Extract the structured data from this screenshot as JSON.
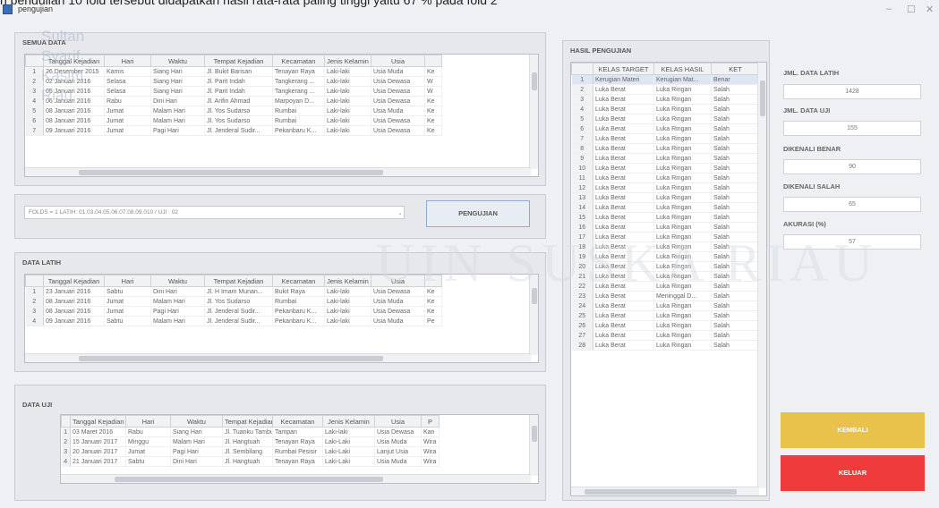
{
  "top_caption": "n pengujian 10 fold tersebut didapatkan hasil rata-rata paling tinggi yaitu 67 % pada fold 2",
  "window": {
    "title": "pengujian",
    "min": "–",
    "max": "☐",
    "close": "✕"
  },
  "semua": {
    "title": "SEMUA DATA",
    "headers": [
      "",
      "Tanggal Kejadian",
      "Hari",
      "Waktu",
      "Tempat Kejadian",
      "Kecamatan",
      "Jenis Kelamin",
      "Usia",
      ""
    ],
    "rows": [
      [
        "1",
        "26 Desember 2015",
        "Kamis",
        "Siang Hari",
        "Jl. Bukit Barisan",
        "Tenayan Raya",
        "Laki-laki",
        "Usia Muda",
        "Ke"
      ],
      [
        "2",
        "02 Januari 2016",
        "Selasa",
        "Siang Hari",
        "Jl. Parit Indah",
        "Tangkerang ...",
        "Laki-laki",
        "Usia Dewasa",
        "W"
      ],
      [
        "3",
        "05 Januari 2016",
        "Selasa",
        "Siang Hari",
        "Jl. Parit Indah",
        "Tangkerang ...",
        "Laki-laki",
        "Usia Dewasa",
        "W"
      ],
      [
        "4",
        "06 Januari 2016",
        "Rabu",
        "Dini Hari",
        "Jl. Arifin Ahmad",
        "Marpoyan D...",
        "Laki-laki",
        "Usia Dewasa",
        "Ke"
      ],
      [
        "5",
        "08 Januari 2016",
        "Jumat",
        "Malam Hari",
        "Jl. Yos Sudarso",
        "Rumbai",
        "Laki-laki",
        "Usia Muda",
        "Ke"
      ],
      [
        "6",
        "08 Januari 2016",
        "Jumat",
        "Malam Hari",
        "Jl. Yos Sudarso",
        "Rumbai",
        "Laki-laki",
        "Usia Dewasa",
        "Ke"
      ],
      [
        "7",
        "09 Januari 2016",
        "Jumat",
        "Pagi Hari",
        "Jl. Jenderal Sudir...",
        "Pekanbaru K...",
        "Laki-laki",
        "Usia Dewasa",
        "Ke"
      ]
    ]
  },
  "control": {
    "combo_value": "FOLDS = 1 LATIH: 01.03.04.05.06.07.08.09.010 / UJI : 02",
    "button": "PENGUJIAN"
  },
  "latih": {
    "title": "DATA LATIH",
    "headers": [
      "",
      "Tanggal Kejadian",
      "Hari",
      "Waktu",
      "Tempat Kejadian",
      "Kecamatan",
      "Jenis Kelamin",
      "Usia",
      ""
    ],
    "rows": [
      [
        "1",
        "23 Januari 2016",
        "Sabtu",
        "Dini Hari",
        "Jl. H Imam Munan...",
        "Bukit Raya",
        "Laki-laki",
        "Usia Dewasa",
        "Ke"
      ],
      [
        "2",
        "08 Januari 2016",
        "Jumat",
        "Malam Hari",
        "Jl. Yos Sudarso",
        "Rumbai",
        "Laki-laki",
        "Usia Muda",
        "Ke"
      ],
      [
        "3",
        "08 Januari 2016",
        "Jumat",
        "Pagi Hari",
        "Jl. Jenderal Sudir...",
        "Pekanbaru K...",
        "Laki-laki",
        "Usia Dewasa",
        "Ke"
      ],
      [
        "4",
        "09 Januari 2016",
        "Sabtu",
        "Malam Hari",
        "Jl. Jenderal Sudir...",
        "Pekanbaru K...",
        "Laki-laki",
        "Usia Muda",
        "Pe"
      ]
    ]
  },
  "uji": {
    "title": "DATA UJI",
    "headers": [
      "",
      "Tanggal Kejadian",
      "Hari",
      "Waktu",
      "Tempat Kejadian",
      "Kecamatan",
      "Jenis Kelamin",
      "Usia",
      "P"
    ],
    "rows": [
      [
        "1",
        "03 Maret 2016",
        "Rabu",
        "Siang Hari",
        "Jl. Tuanku Tambu...",
        "Tampan",
        "Laki-laki",
        "Usia Dewasa",
        "Kan"
      ],
      [
        "2",
        "15 Januari 2017",
        "Minggu",
        "Malam Hari",
        "Jl. Hangtuah",
        "Tenayan Raya",
        "Laki-Laki",
        "Usia Muda",
        "Wira"
      ],
      [
        "3",
        "20 Januari 2017",
        "Jumat",
        "Pagi Hari",
        "Jl. Sembilang",
        "Rumbai Pesisir",
        "Laki-Laki",
        "Lanjut Usia",
        "Wira"
      ],
      [
        "4",
        "21 Januari 2017",
        "Sabtu",
        "Dini Hari",
        "Jl. Hangtuah",
        "Tenayan Raya",
        "Laki-Laki",
        "Usia Muda",
        "Wira"
      ]
    ]
  },
  "hasil": {
    "title": "HASIL PENGUJIAN",
    "headers": [
      "",
      "KELAS TARGET",
      "KELAS HASIL",
      "KET"
    ],
    "rows": [
      [
        "1",
        "Kerugian Materi",
        "Kerugian Mat...",
        "Benar"
      ],
      [
        "2",
        "Luka Berat",
        "Luka Ringan",
        "Salah"
      ],
      [
        "3",
        "Luka Berat",
        "Luka Ringan",
        "Salah"
      ],
      [
        "4",
        "Luka Berat",
        "Luka Ringan",
        "Salah"
      ],
      [
        "5",
        "Luka Berat",
        "Luka Ringan",
        "Salah"
      ],
      [
        "6",
        "Luka Berat",
        "Luka Ringan",
        "Salah"
      ],
      [
        "7",
        "Luka Berat",
        "Luka Ringan",
        "Salah"
      ],
      [
        "8",
        "Luka Berat",
        "Luka Ringan",
        "Salah"
      ],
      [
        "9",
        "Luka Berat",
        "Luka Ringan",
        "Salah"
      ],
      [
        "10",
        "Luka Berat",
        "Luka Ringan",
        "Salah"
      ],
      [
        "11",
        "Luka Berat",
        "Luka Ringan",
        "Salah"
      ],
      [
        "12",
        "Luka Berat",
        "Luka Ringan",
        "Salah"
      ],
      [
        "13",
        "Luka Berat",
        "Luka Ringan",
        "Salah"
      ],
      [
        "14",
        "Luka Berat",
        "Luka Ringan",
        "Salah"
      ],
      [
        "15",
        "Luka Berat",
        "Luka Ringan",
        "Salah"
      ],
      [
        "16",
        "Luka Berat",
        "Luka Ringan",
        "Salah"
      ],
      [
        "17",
        "Luka Berat",
        "Luka Ringan",
        "Salah"
      ],
      [
        "18",
        "Luka Berat",
        "Luka Ringan",
        "Salah"
      ],
      [
        "19",
        "Luka Berat",
        "Luka Ringan",
        "Salah"
      ],
      [
        "20",
        "Luka Berat",
        "Luka Ringan",
        "Salah"
      ],
      [
        "21",
        "Luka Berat",
        "Luka Ringan",
        "Salah"
      ],
      [
        "22",
        "Luka Berat",
        "Luka Ringan",
        "Salah"
      ],
      [
        "23",
        "Luka Berat",
        "Meninggal D...",
        "Salah"
      ],
      [
        "24",
        "Luka Berat",
        "Luka Ringan",
        "Salah"
      ],
      [
        "25",
        "Luka Berat",
        "Luka Ringan",
        "Salah"
      ],
      [
        "26",
        "Luka Berat",
        "Luka Ringan",
        "Salah"
      ],
      [
        "27",
        "Luka Berat",
        "Luka Ringan",
        "Salah"
      ],
      [
        "28",
        "Luka Berat",
        "Luka Ringan",
        "Salah"
      ]
    ]
  },
  "stats": {
    "latih_label": "JML. DATA LATIH",
    "latih_value": "1428",
    "uji_label": "JML. DATA UJI",
    "uji_value": "155",
    "benar_label": "DIKENALI BENAR",
    "benar_value": "90",
    "salah_label": "DIKENALI SALAH",
    "salah_value": "65",
    "akurasi_label": "AKURASI (%)",
    "akurasi_value": "57"
  },
  "buttons": {
    "kembali": "KEMBALI",
    "keluar": "KELUAR"
  },
  "watermark": {
    "vertical": "Sultan Syarif Kasim Riau",
    "side": "UIN SUSKA RIAU"
  },
  "colors": {
    "kembali": "#e9c24b",
    "keluar": "#ef3b3b",
    "selected_row": "#dde6f2"
  }
}
